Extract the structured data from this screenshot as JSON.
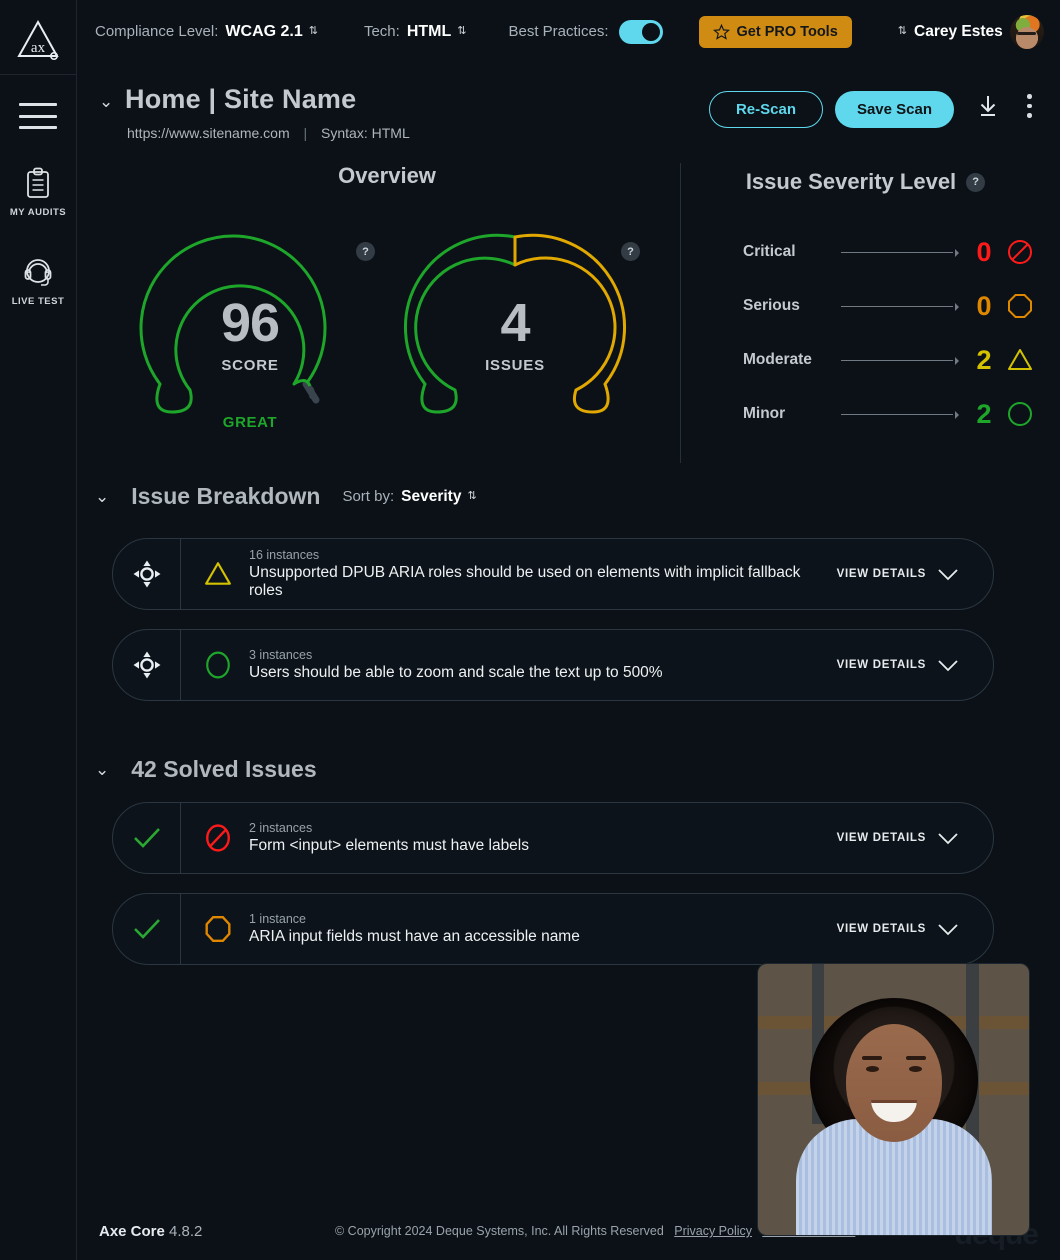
{
  "app": {
    "logo_alt": "axe-logo",
    "deque_watermark": "deque"
  },
  "rail": {
    "menu_icon": "hamburger-icon",
    "items": [
      {
        "label": "MY AUDITS",
        "icon": "clipboard-icon"
      },
      {
        "label": "LIVE TEST",
        "icon": "headset-icon"
      }
    ]
  },
  "topbar": {
    "compliance_label": "Compliance Level:",
    "compliance_value": "WCAG 2.1",
    "tech_label": "Tech:",
    "tech_value": "HTML",
    "best_practices_label": "Best Practices:",
    "best_practices_on": true,
    "pro_button": "Get PRO Tools",
    "pro_icon": "star-icon",
    "user_name": "Carey Estes"
  },
  "page": {
    "title": "Home  |  Site Name",
    "url": "https://www.sitename.com",
    "syntax": "Syntax: HTML",
    "rescan_label": "Re-Scan",
    "save_label": "Save Scan",
    "download_icon": "download-icon",
    "more_icon": "kebab-menu-icon"
  },
  "overview": {
    "title": "Overview",
    "score": {
      "value": "96",
      "label": "SCORE",
      "rating": "GREAT",
      "percent": 96,
      "color": "#1ea62a",
      "track_color": "#39444d"
    },
    "issues": {
      "value": "4",
      "label": "ISSUES",
      "green_percent": 50,
      "green_color": "#1ea62a",
      "amber_color": "#e0a800"
    },
    "help_icon": "question-mark-icon"
  },
  "severity": {
    "title": "Issue Severity Level",
    "help_icon": "question-mark-icon",
    "rows": [
      {
        "name": "Critical",
        "count": "0",
        "color": "#ff1a1a",
        "icon": "no-entry-icon"
      },
      {
        "name": "Serious",
        "count": "0",
        "color": "#e08700",
        "icon": "octagon-icon"
      },
      {
        "name": "Moderate",
        "count": "2",
        "color": "#d4c200",
        "icon": "triangle-icon"
      },
      {
        "name": "Minor",
        "count": "2",
        "color": "#1ea62a",
        "icon": "circle-icon"
      }
    ]
  },
  "issue_breakdown": {
    "title": "Issue Breakdown",
    "sort_label": "Sort by:",
    "sort_value": "Severity",
    "view_details": "VIEW DETAILS",
    "items": [
      {
        "instances": "16 instances",
        "description": "Unsupported DPUB ARIA roles should be used on elements with implicit fallback roles",
        "severity_icon": "triangle-icon",
        "severity_color": "#d4c200",
        "left_icon": "crosshair-icon"
      },
      {
        "instances": "3 instances",
        "description": "Users should be able to zoom and scale the text up to 500%",
        "severity_icon": "circle-icon",
        "severity_color": "#1ea62a",
        "left_icon": "crosshair-icon"
      }
    ]
  },
  "solved_issues": {
    "title": "42 Solved Issues",
    "view_details": "VIEW DETAILS",
    "items": [
      {
        "instances": "2 instances",
        "description": "Form <input> elements must have labels",
        "severity_icon": "no-entry-icon",
        "severity_color": "#ff1a1a",
        "left_icon": "check-icon"
      },
      {
        "instances": "1 instance",
        "description": "ARIA input fields must have an accessible name",
        "severity_icon": "octagon-icon",
        "severity_color": "#e08700",
        "left_icon": "check-icon"
      }
    ]
  },
  "footer": {
    "core_name": "Axe Core",
    "core_version": "4.8.2",
    "copyright": "© Copyright 2024   Deque Systems, Inc.   All Rights Reserved",
    "privacy": "Privacy Policy",
    "terms": "Terms of Service"
  }
}
